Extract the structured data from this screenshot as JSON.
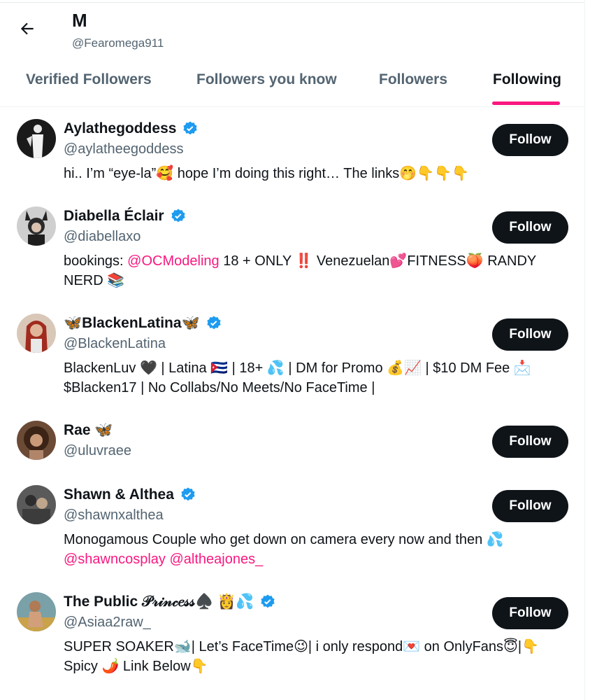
{
  "header": {
    "title": "M",
    "handle": "@Fearomega911"
  },
  "tabs": [
    {
      "label": "Verified Followers",
      "active": false
    },
    {
      "label": "Followers you know",
      "active": false
    },
    {
      "label": "Followers",
      "active": false
    },
    {
      "label": "Following",
      "active": true
    }
  ],
  "colors": {
    "accent": "#f91880",
    "verified": "#1d9bf0",
    "button": "#0f1419",
    "secondary_text": "#536471"
  },
  "follow_label": "Follow",
  "users": [
    {
      "name": "Aylathegoddess",
      "handle": "@aylatheegoddess",
      "verified": true,
      "bio": "hi.. I’m “eye-la”🥰 hope I’m doing this right… The links🤭👇👇👇"
    },
    {
      "name": "Diabella Éclair",
      "handle": "@diabellaxo",
      "verified": true,
      "bio_prefix": "bookings: ",
      "bio_mention": "@OCModeling",
      "bio_suffix": " 18 + ONLY ‼️ Venezuelan💕FITNESS🍑 RANDY NERD 📚"
    },
    {
      "name": "🦋BlackenLatina🦋",
      "handle": "@BlackenLatina",
      "verified": true,
      "bio": "BlackenLuv 🖤 | Latina 🇨🇺 | 18+ 💦 | DM for Promo 💰📈 | $10 DM Fee 📩 $Blacken17 | No Collabs/No Meets/No FaceTime |"
    },
    {
      "name": "Rae 🦋",
      "handle": "@uluvraee",
      "verified": false,
      "bio": ""
    },
    {
      "name": "Shawn & Althea",
      "handle": "@shawnxalthea",
      "verified": true,
      "bio": "Monogamous Couple who get down on camera every now and then 💦",
      "bio_mention": "@shawncosplay @altheajones_"
    },
    {
      "name": "The Public 𝒫𝓇𝒾𝓃𝒸𝑒𝓈𝓈♠️ 👸💦",
      "handle": "@Asiaa2raw_",
      "verified": true,
      "bio": "SUPER SOAKER🐋| Let’s FaceTime😉| i only respond💌 on OnlyFans😇|👇 Spicy 🌶️ Link Below👇"
    }
  ]
}
